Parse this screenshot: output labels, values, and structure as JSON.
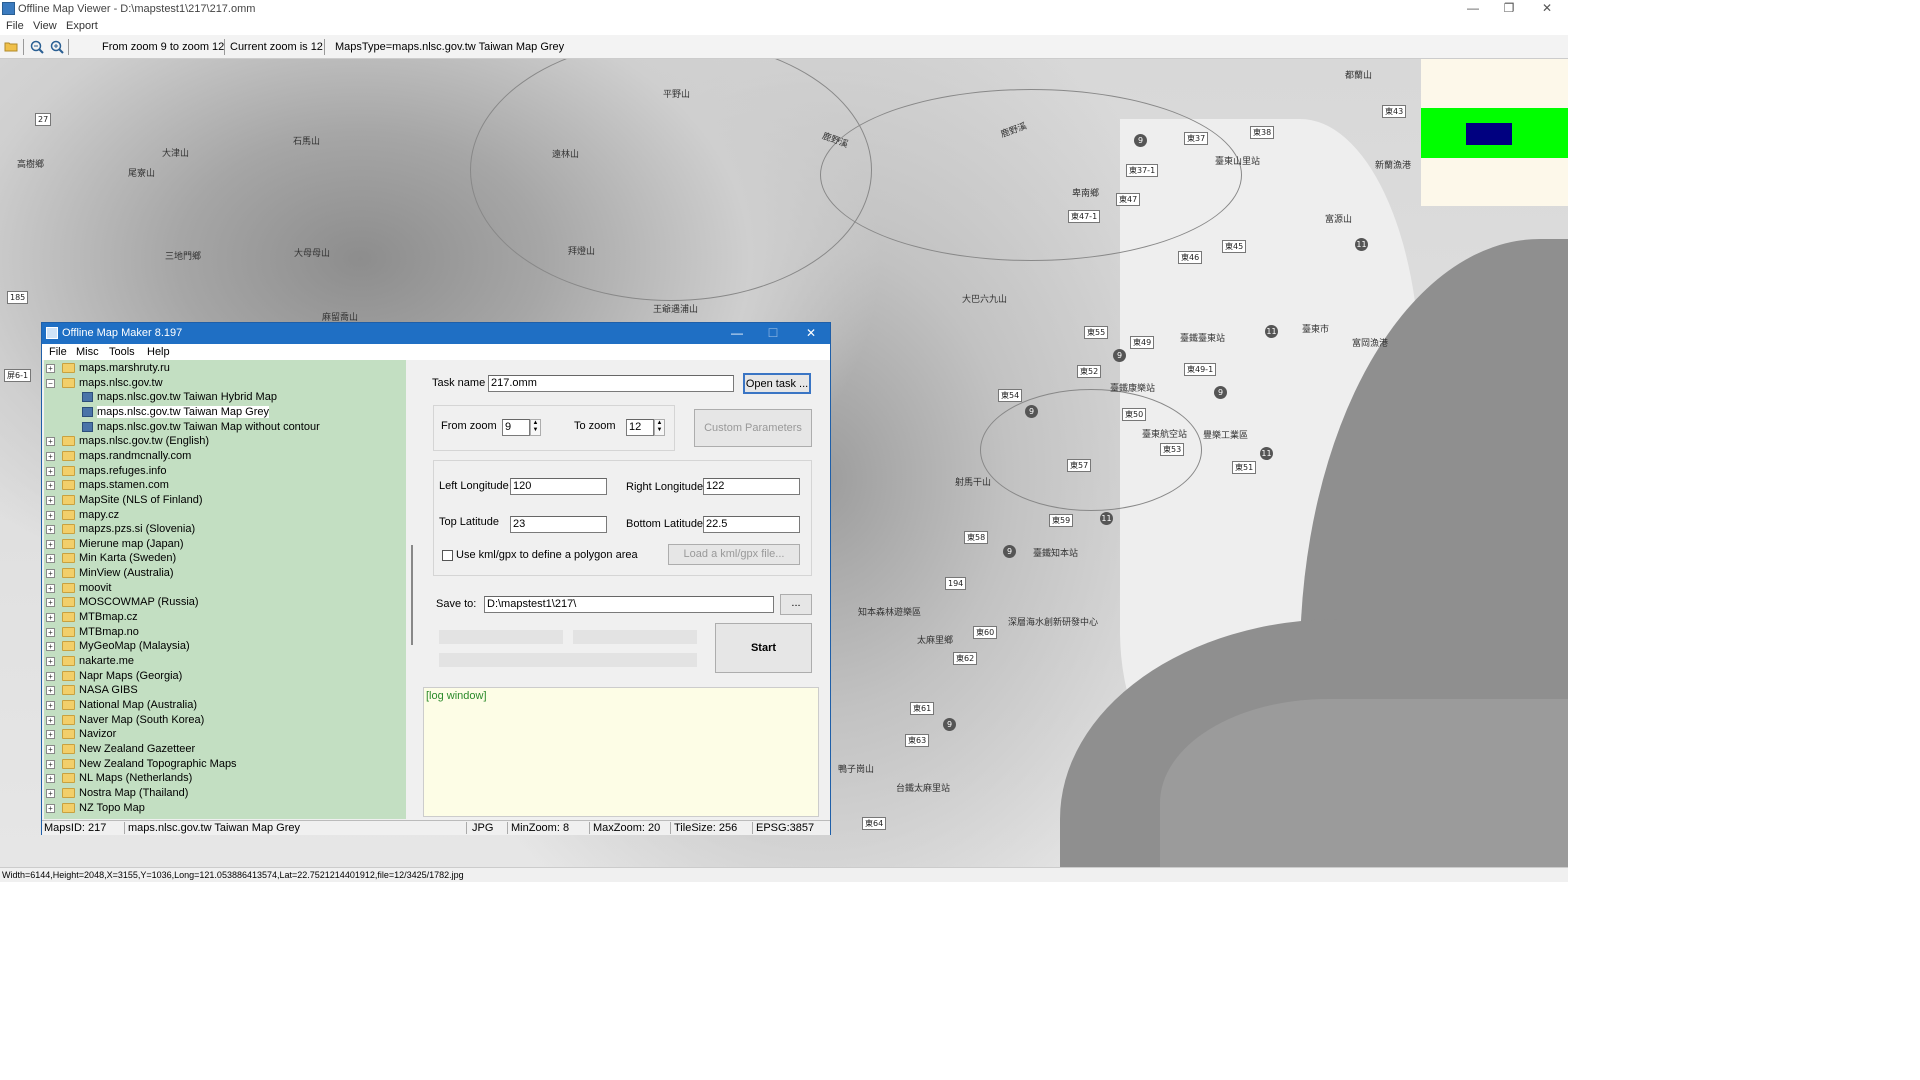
{
  "window": {
    "title": "Offline Map Viewer - D:\\mapstest1\\217\\217.omm",
    "minimize": "—",
    "maximize": "❐",
    "close": "✕"
  },
  "menu": [
    "File",
    "View",
    "Export"
  ],
  "toolbar": {
    "zoom_range": "From zoom 9 to zoom 12",
    "current_zoom": "Current zoom is 12",
    "maps_type": "MapsType=maps.nlsc.gov.tw Taiwan Map Grey"
  },
  "map": {
    "places": [
      "平野山",
      "大津山",
      "石馬山",
      "遠林山",
      "尾寮山",
      "高樹鄉",
      "三地門鄉",
      "大母母山",
      "拜燈山",
      "王爺遇浦山",
      "麻留喬山",
      "鹿野溪",
      "鹿野溪",
      "卑南鄉",
      "大巴六九山",
      "富源山",
      "新蘭漁港",
      "臺東山里站",
      "臺鐵臺東站",
      "臺東市",
      "富岡漁港",
      "臺鐵康樂站",
      "臺東航空站",
      "豐樂工業區",
      "射馬干山",
      "知本森林遊樂區",
      "太麻里鄉",
      "深層海水創新研發中心",
      "臺鐵知本站",
      "鴨子崗山",
      "台鐵太麻里站",
      "都蘭山"
    ],
    "shields": [
      "東37",
      "東38",
      "東37-1",
      "東47",
      "東47-1",
      "東45",
      "東46",
      "東43",
      "東55",
      "東49",
      "東49-1",
      "東52",
      "東54",
      "東50",
      "東53",
      "東51",
      "東57",
      "東59",
      "東58",
      "東60",
      "東62",
      "東61",
      "東63",
      "東64",
      "194",
      "185",
      "27",
      "屏6-1"
    ],
    "route_markers": [
      "9",
      "11",
      "9",
      "11",
      "9",
      "9",
      "11",
      "11",
      "9",
      "9"
    ]
  },
  "minimap": {
    "frame_color": "#00ff00",
    "view_color": "#000080",
    "background": "#fdf8ea"
  },
  "status_bar": "Width=6144,Height=2048,X=3155,Y=1036,Long=121.053886413574,Lat=22.7521214401912,file=12/3425/1782.jpg",
  "dialog": {
    "title": "Offline Map Maker 8.197",
    "menu": [
      "File",
      "Misc",
      "Tools",
      "Help"
    ],
    "tree": [
      {
        "label": "maps.marshruty.ru",
        "level": 0,
        "expanded": false
      },
      {
        "label": "maps.nlsc.gov.tw",
        "level": 0,
        "expanded": true
      },
      {
        "label": "maps.nlsc.gov.tw Taiwan Hybrid Map",
        "level": 1
      },
      {
        "label": "maps.nlsc.gov.tw Taiwan Map Grey",
        "level": 1,
        "selected": true
      },
      {
        "label": "maps.nlsc.gov.tw Taiwan Map without contour",
        "level": 1
      },
      {
        "label": "maps.nlsc.gov.tw (English)",
        "level": 0
      },
      {
        "label": "maps.randmcnally.com",
        "level": 0
      },
      {
        "label": "maps.refuges.info",
        "level": 0
      },
      {
        "label": "maps.stamen.com",
        "level": 0
      },
      {
        "label": "MapSite (NLS of Finland)",
        "level": 0
      },
      {
        "label": "mapy.cz",
        "level": 0
      },
      {
        "label": "mapzs.pzs.si (Slovenia)",
        "level": 0
      },
      {
        "label": "Mierune map (Japan)",
        "level": 0
      },
      {
        "label": "Min Karta (Sweden)",
        "level": 0
      },
      {
        "label": "MinView (Australia)",
        "level": 0
      },
      {
        "label": "moovit",
        "level": 0
      },
      {
        "label": "MOSCOWMAP (Russia)",
        "level": 0
      },
      {
        "label": "MTBmap.cz",
        "level": 0
      },
      {
        "label": "MTBmap.no",
        "level": 0
      },
      {
        "label": "MyGeoMap (Malaysia)",
        "level": 0
      },
      {
        "label": "nakarte.me",
        "level": 0
      },
      {
        "label": "Napr Maps (Georgia)",
        "level": 0
      },
      {
        "label": "NASA GIBS",
        "level": 0
      },
      {
        "label": "National Map (Australia)",
        "level": 0
      },
      {
        "label": "Naver Map (South Korea)",
        "level": 0
      },
      {
        "label": "Navizor",
        "level": 0
      },
      {
        "label": "New Zealand Gazetteer",
        "level": 0
      },
      {
        "label": "New Zealand Topographic Maps",
        "level": 0
      },
      {
        "label": "NL Maps (Netherlands)",
        "level": 0
      },
      {
        "label": "Nostra Map (Thailand)",
        "level": 0
      },
      {
        "label": "NZ Topo Map",
        "level": 0
      }
    ],
    "task_name_label": "Task name",
    "task_name": "217.omm",
    "open_task": "Open task ...",
    "from_zoom_label": "From zoom",
    "from_zoom": "9",
    "to_zoom_label": "To zoom",
    "to_zoom": "12",
    "custom_params": "Custom Parameters",
    "left_lon_label": "Left Longitude",
    "left_lon": "120",
    "right_lon_label": "Right Longitude",
    "right_lon": "122",
    "top_lat_label": "Top Latitude",
    "top_lat": "23",
    "bottom_lat_label": "Bottom Latitude",
    "bottom_lat": "22.5",
    "use_kml_label": "Use kml/gpx to define a polygon area",
    "load_kml": "Load a kml/gpx file...",
    "save_to_label": "Save to:",
    "save_to": "D:\\mapstest1\\217\\",
    "browse": "...",
    "start": "Start",
    "log": "[log window]",
    "status": {
      "maps_id": "MapsID: 217",
      "maps_name": "maps.nlsc.gov.tw Taiwan Map Grey",
      "format": "JPG",
      "min_zoom": "MinZoom: 8",
      "max_zoom": "MaxZoom: 20",
      "tile_size": "TileSize: 256",
      "epsg": "EPSG:3857"
    }
  }
}
